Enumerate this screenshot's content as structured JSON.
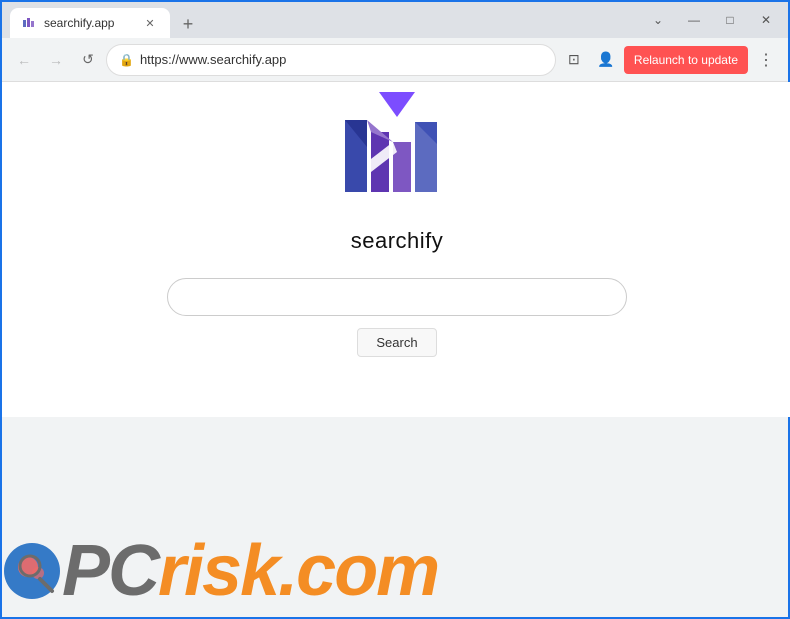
{
  "browser": {
    "tab": {
      "title": "searchify.app",
      "favicon": "🔍"
    },
    "new_tab_label": "+",
    "controls": {
      "minimize": "—",
      "maximize": "□",
      "close": "✕"
    },
    "nav": {
      "back": "←",
      "forward": "→",
      "reload": "↺"
    },
    "address": "https://www.searchify.app",
    "lock_icon": "🔒",
    "tab_icon": "⊡",
    "profile_icon": "👤",
    "relaunch_label": "Relaunch to update",
    "menu_icon": "⋮"
  },
  "page": {
    "site_name": "searchify",
    "search_placeholder": "",
    "search_button_label": "Search",
    "logo_alt": "Searchify logo"
  },
  "watermark": {
    "pc": "PC",
    "risk": "risk",
    "dot_com": ".com"
  }
}
